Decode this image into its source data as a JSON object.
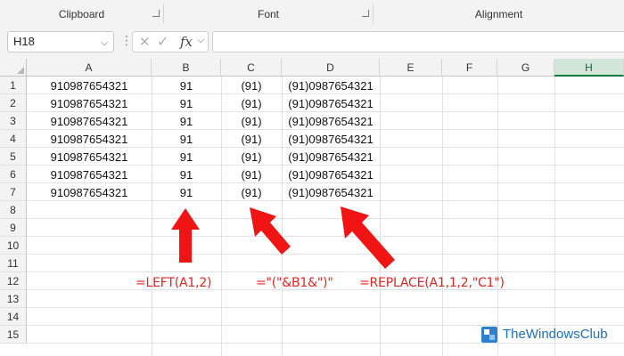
{
  "ribbon": {
    "groups": [
      {
        "label": "Clipboard",
        "launcher": true
      },
      {
        "label": "Font",
        "launcher": true
      },
      {
        "label": "Alignment",
        "launcher": false
      }
    ]
  },
  "formula_bar": {
    "name_box": "H18",
    "formula": "",
    "icons": [
      "cancel-icon",
      "enter-check-icon",
      "function-fx-icon"
    ]
  },
  "sheet": {
    "columns": [
      "A",
      "B",
      "C",
      "D",
      "E",
      "F",
      "G",
      "H"
    ],
    "selected_column": "H",
    "row_numbers": [
      "1",
      "2",
      "3",
      "4",
      "5",
      "6",
      "7",
      "8",
      "9",
      "10",
      "11",
      "12",
      "13",
      "14",
      "15"
    ],
    "rows": [
      [
        "910987654321",
        "91",
        "(91)",
        "(91)0987654321"
      ],
      [
        "910987654321",
        "91",
        "(91)",
        "(91)0987654321"
      ],
      [
        "910987654321",
        "91",
        "(91)",
        "(91)0987654321"
      ],
      [
        "910987654321",
        "91",
        "(91)",
        "(91)0987654321"
      ],
      [
        "910987654321",
        "91",
        "(91)",
        "(91)0987654321"
      ],
      [
        "910987654321",
        "91",
        "(91)",
        "(91)0987654321"
      ],
      [
        "910987654321",
        "91",
        "(91)",
        "(91)0987654321"
      ]
    ]
  },
  "annotations": {
    "color": "#e32222",
    "labels": [
      "=LEFT(A1,2)",
      "=\"(\"&B1&\")\"",
      "=REPLACE(A1,1,2,\"C1\")"
    ]
  },
  "watermark": {
    "text": "TheWindowsClub"
  },
  "colors": {
    "selected_header_bg": "#d2e6d9",
    "selected_header_accent": "#107c41",
    "gridline": "#e1e1e1"
  }
}
